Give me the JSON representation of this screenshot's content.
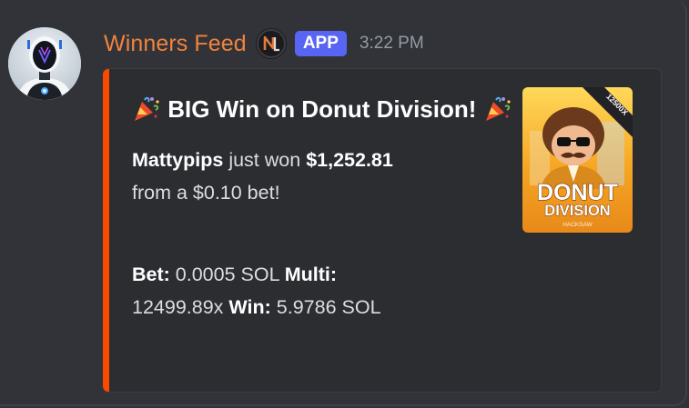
{
  "message": {
    "username": "Winners Feed",
    "badge": "APP",
    "timestamp": "3:22 PM",
    "avatar_icon": "robot-avatar-icon",
    "role_icon": "nl-role-icon"
  },
  "embed": {
    "accent_color": "#fa4a00",
    "title_emoji_left": "party-popper-icon",
    "title": "BIG Win on Donut Division!",
    "title_emoji_right": "party-popper-icon",
    "player": "Mattypips",
    "won_text": "just won",
    "win_amount": "$1,252.81",
    "bet_text": "from a $0.10 bet!",
    "bet_label": "Bet:",
    "bet_value": "0.0005 SOL",
    "multi_label": "Multi:",
    "multi_value": "12499.89x",
    "win_label": "Win:",
    "win_value": "5.9786 SOL",
    "thumbnail": {
      "ribbon": "12500X",
      "line1": "DONUT",
      "line2": "DIVISION",
      "provider": "HACKSAW"
    }
  },
  "colors": {
    "background": "#313338",
    "embed_bg": "#2b2d31",
    "username": "#f0833e",
    "badge": "#5865f2"
  }
}
